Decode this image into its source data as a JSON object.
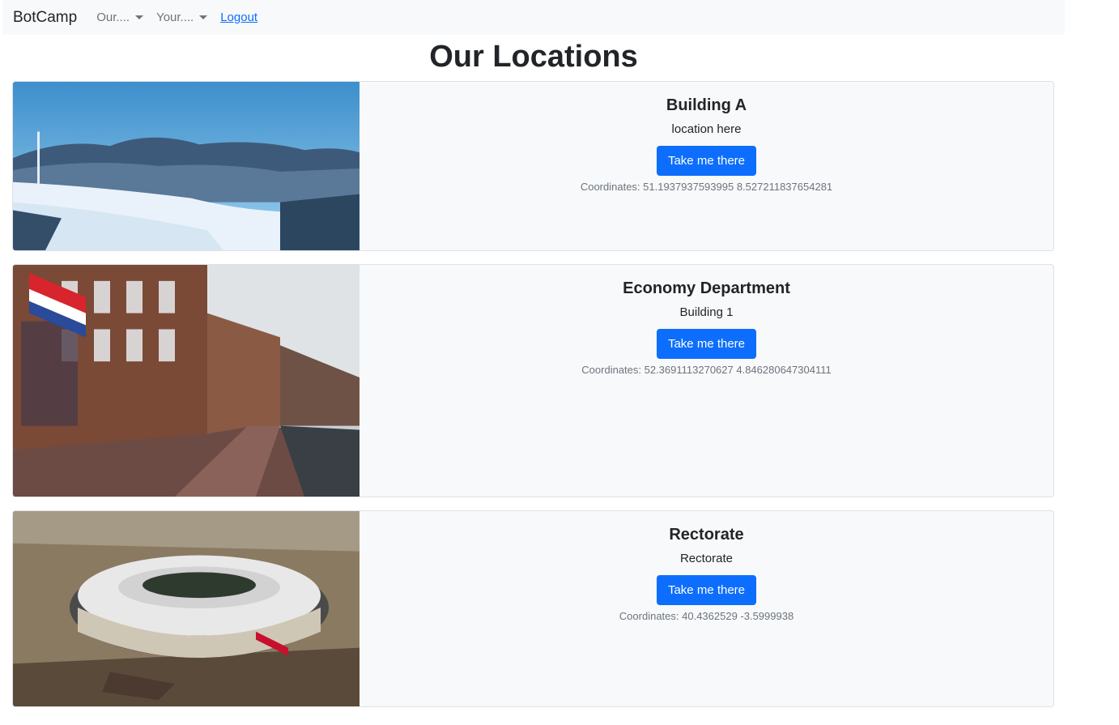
{
  "nav": {
    "brand": "BotCamp",
    "dropdown_1": "Our....",
    "dropdown_2": "Your....",
    "logout": "Logout"
  },
  "page": {
    "title": "Our Locations"
  },
  "locations": [
    {
      "title": "Building A",
      "description": "location here",
      "button": "Take me there",
      "coordinates": "Coordinates: 51.1937937593995 8.527211837654281",
      "image": "snowy-hills-town"
    },
    {
      "title": "Economy Department",
      "description": "Building 1",
      "button": "Take me there",
      "coordinates": "Coordinates: 52.3691113270627 4.846280647304111",
      "image": "dutch-canal-street"
    },
    {
      "title": "Rectorate",
      "description": "Rectorate",
      "button": "Take me there",
      "coordinates": "Coordinates: 40.4362529 -3.5999938",
      "image": "stadium-aerial"
    }
  ],
  "colors": {
    "primary": "#0d6efd",
    "navbar_bg": "#f8f9fa",
    "card_bg": "#f8f9fa",
    "muted": "#6c757d"
  }
}
